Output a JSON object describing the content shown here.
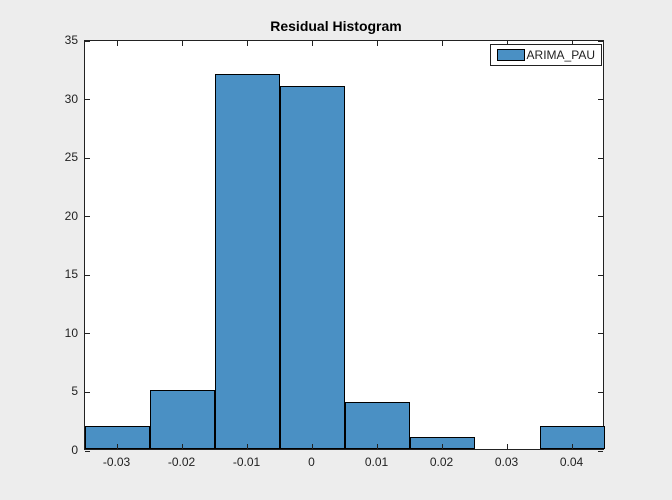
{
  "chart_data": {
    "type": "bar",
    "title": "Residual Histogram",
    "xlabel": "",
    "ylabel": "",
    "xlim": [
      -0.035,
      0.045
    ],
    "ylim": [
      0,
      35
    ],
    "x_ticks": [
      -0.03,
      -0.02,
      -0.01,
      0,
      0.01,
      0.02,
      0.03,
      0.04
    ],
    "y_ticks": [
      0,
      5,
      10,
      15,
      20,
      25,
      30,
      35
    ],
    "bin_edges": [
      -0.035,
      -0.025,
      -0.015,
      -0.005,
      0.005,
      0.015,
      0.025,
      0.035,
      0.045
    ],
    "series": [
      {
        "name": "ARIMA_PAU",
        "values": [
          2,
          5,
          32,
          31,
          4,
          1,
          0,
          2
        ]
      }
    ],
    "legend_position": "northeast"
  },
  "x_ticklabels": [
    "-0.03",
    "-0.02",
    "-0.01",
    "0",
    "0.01",
    "0.02",
    "0.03",
    "0.04"
  ],
  "y_ticklabels": [
    "0",
    "5",
    "10",
    "15",
    "20",
    "25",
    "30",
    "35"
  ],
  "colors": {
    "bar_fill": "#4a90c4",
    "bar_edge": "#000000",
    "bg": "#ededed",
    "axes_bg": "#ffffff"
  }
}
